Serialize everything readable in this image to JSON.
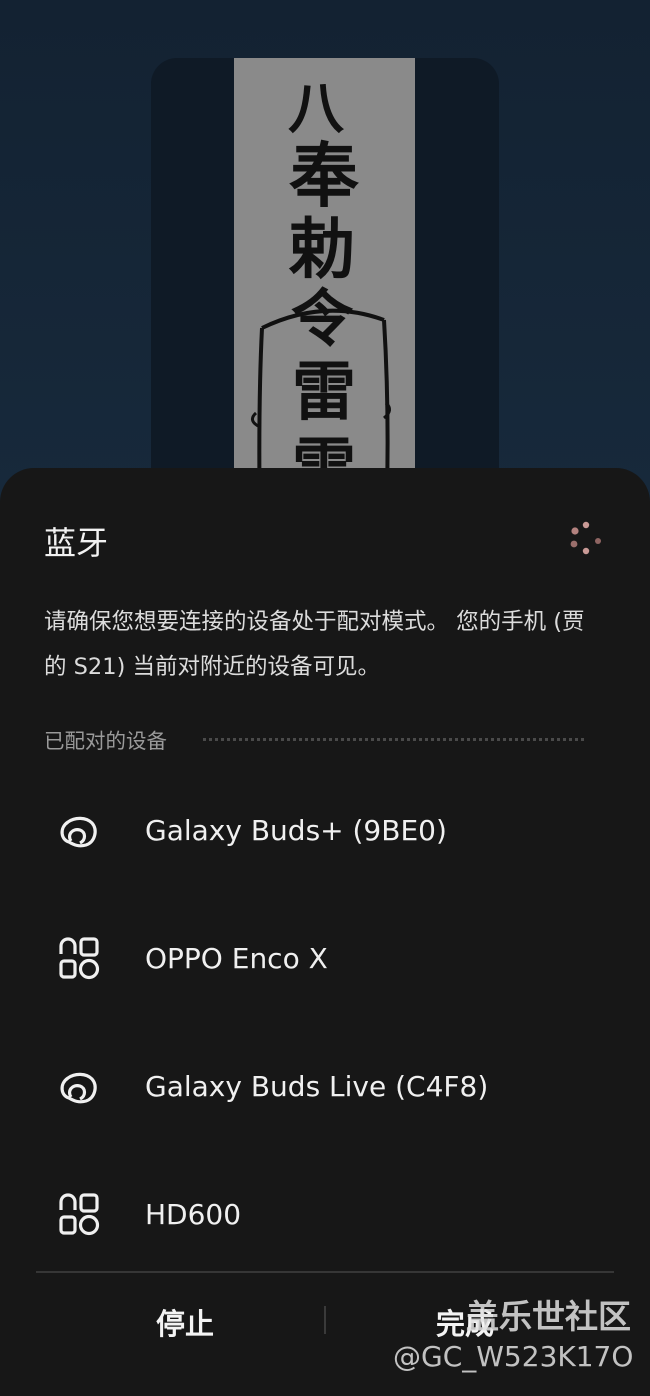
{
  "background": {
    "talisman_text": [
      "八",
      "奉",
      "勅",
      "令",
      "雷",
      "雷"
    ]
  },
  "dialog": {
    "title": "蓝牙",
    "description": "请确保您想要连接的设备处于配对模式。 您的手机 (贾的 S21) 当前对附近的设备可见。",
    "paired_section_label": "已配对的设备",
    "devices": [
      {
        "name": "Galaxy Buds+ (9BE0)",
        "icon": "earbuds-icon"
      },
      {
        "name": "OPPO Enco X",
        "icon": "generic-device-icon"
      },
      {
        "name": "Galaxy Buds Live (C4F8)",
        "icon": "earbuds-icon"
      },
      {
        "name": "HD600",
        "icon": "generic-device-icon"
      }
    ],
    "stop_button": "停止",
    "done_button": "完成"
  },
  "watermark": {
    "main": "盖乐世社区",
    "sub": "@GC_W523K17O"
  },
  "colors": {
    "sheet_bg": "#171717",
    "page_bg": "#17293b",
    "spinner_accent": "#c99a96"
  }
}
